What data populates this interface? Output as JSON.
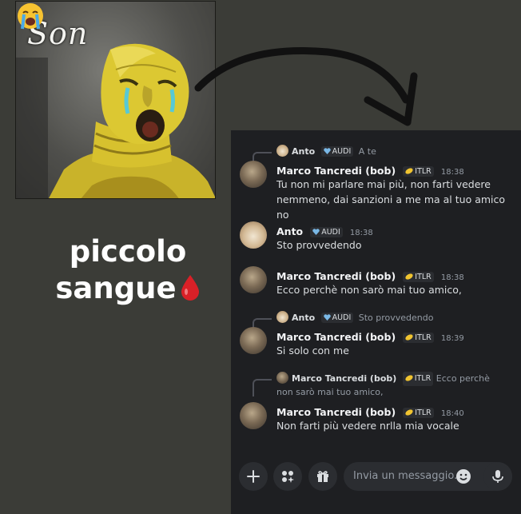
{
  "meme": {
    "caption": "Son",
    "emoji": "loudly-crying-face-icon"
  },
  "side_text": {
    "line1": "piccolo",
    "line2": "sangue",
    "emoji": "drop-of-blood-icon"
  },
  "chat": {
    "messages": [
      {
        "reply_to": {
          "author": "Anto",
          "tag": "AUDI",
          "text": "A te"
        },
        "author": "Marco Tancredi (bob)",
        "tag": "ITLR",
        "time": "18:38",
        "text": "Tu non mi parlare mai più, non farti vedere nemmeno, dai sanzioni a me ma al tuo amico no"
      },
      {
        "author": "Anto",
        "tag": "AUDI",
        "time": "18:38",
        "text": "Sto provvedendo"
      },
      {
        "author": "Marco Tancredi (bob)",
        "tag": "ITLR",
        "time": "18:38",
        "text": "Ecco perchè non sarò mai tuo amico,"
      },
      {
        "reply_to": {
          "author": "Anto",
          "tag": "AUDI",
          "text": "Sto provvedendo"
        },
        "author": "Marco Tancredi (bob)",
        "tag": "ITLR",
        "time": "18:39",
        "text": "Si solo con me"
      },
      {
        "reply_to": {
          "author": "Marco Tancredi (bob)",
          "tag": "ITLR",
          "text": "Ecco perchè non sarò mai tuo amico,"
        },
        "author": "Marco Tancredi (bob)",
        "tag": "ITLR",
        "time": "18:40",
        "text": "Non farti più vedere nrlla mia vocale"
      }
    ]
  },
  "composer": {
    "placeholder": "Invia un messaggio..",
    "buttons": [
      "plus-icon",
      "apps-icon",
      "gift-icon",
      "emoji-icon",
      "microphone-icon"
    ]
  },
  "colors": {
    "background": "#3b3c37",
    "chat_bg": "#1e1f22",
    "tag_bg": "#2b2d31",
    "itlr_icon": "#f0c430",
    "audi_icon": "#7ab8e6",
    "blood": "#d92027"
  }
}
